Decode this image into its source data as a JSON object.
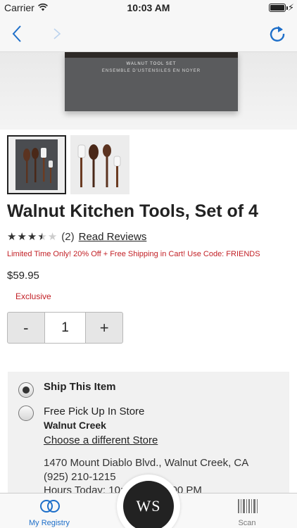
{
  "status_bar": {
    "carrier": "Carrier",
    "time": "10:03 AM",
    "battery_level": 1.0
  },
  "nav": {
    "back_icon": "chevron-left-icon",
    "forward_icon": "chevron-right-icon",
    "refresh_icon": "refresh-icon"
  },
  "hero": {
    "box_title": "WALNUT TOOL SET",
    "box_subtitle": "ENSEMBLE D'USTENSILES EN NOYER"
  },
  "product": {
    "title": "Walnut Kitchen Tools, Set of 4",
    "rating": 3.5,
    "review_count": "(2)",
    "read_reviews": "Read Reviews",
    "promo": "Limited Time Only! 20% Off + Free Shipping in Cart! Use Code: FRIENDS",
    "price": "$59.95",
    "badge": "Exclusive"
  },
  "quantity": {
    "minus": "-",
    "value": "1",
    "plus": "+"
  },
  "fulfillment": {
    "ship_label": "Ship This Item",
    "ship_selected": true,
    "pickup_label": "Free Pick Up In Store",
    "store_name": "Walnut Creek",
    "change_store": "Choose a different Store",
    "address": "1470 Mount Diablo Blvd., Walnut Creek, CA",
    "phone": "(925) 210-1215",
    "hours": "Hours Today: 10:00 AM - 8:00 PM"
  },
  "tab_bar": {
    "registry_label": "My Registry",
    "logo_text": "WS",
    "scan_label": "Scan"
  },
  "colors": {
    "accent_blue": "#1e6fc9",
    "promo_red": "#c21f25"
  }
}
